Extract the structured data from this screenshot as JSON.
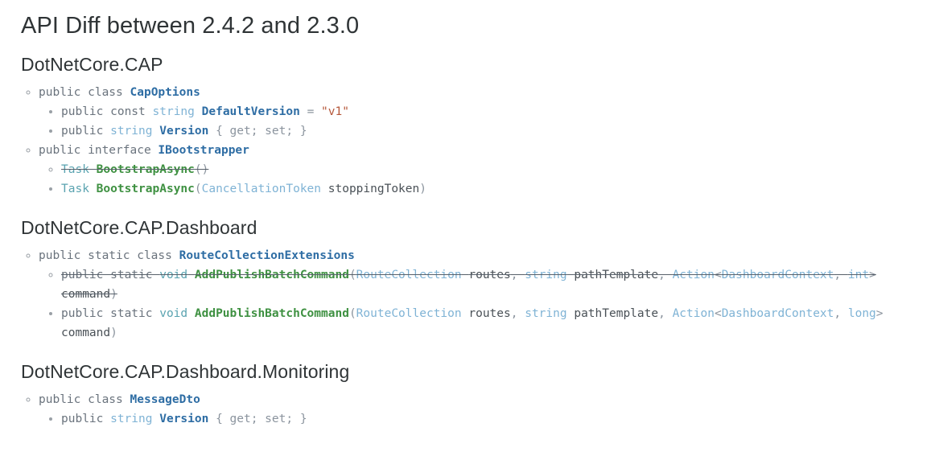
{
  "document": {
    "title": "API Diff between 2.4.2 and 2.3.0"
  },
  "colors": {
    "background": "#ffffff",
    "title": "#2f3436",
    "keyword": "#6a737d",
    "type": "#7fb3d5",
    "identifier": "#2e6da4",
    "method": "#3f9142",
    "string": "#b5573a",
    "removed_strike": "#57606a"
  },
  "namespaces": [
    {
      "name": "DotNetCore.CAP",
      "members": [
        {
          "kind": "class",
          "status": "unchanged",
          "tokens": [
            {
              "t": "public class ",
              "c": "kw"
            },
            {
              "t": "CapOptions",
              "c": "id"
            }
          ],
          "children": [
            {
              "status": "added",
              "tokens": [
                {
                  "t": "public const ",
                  "c": "kw"
                },
                {
                  "t": "string",
                  "c": "type"
                },
                {
                  "t": " ",
                  "c": "kw"
                },
                {
                  "t": "DefaultVersion",
                  "c": "id"
                },
                {
                  "t": " = ",
                  "c": "punc"
                },
                {
                  "t": "\"v1\"",
                  "c": "str"
                }
              ]
            },
            {
              "status": "added",
              "tokens": [
                {
                  "t": "public ",
                  "c": "kw"
                },
                {
                  "t": "string",
                  "c": "type"
                },
                {
                  "t": " ",
                  "c": "kw"
                },
                {
                  "t": "Version",
                  "c": "id"
                },
                {
                  "t": " { get; set; }",
                  "c": "punc"
                }
              ]
            }
          ]
        },
        {
          "kind": "interface",
          "status": "unchanged",
          "tokens": [
            {
              "t": "public interface ",
              "c": "kw"
            },
            {
              "t": "IBootstrapper",
              "c": "id"
            }
          ],
          "children": [
            {
              "status": "removed",
              "tokens": [
                {
                  "t": "Task",
                  "c": "tealtype"
                },
                {
                  "t": " ",
                  "c": "kw"
                },
                {
                  "t": "BootstrapAsync",
                  "c": "fn"
                },
                {
                  "t": "()",
                  "c": "punc"
                }
              ]
            },
            {
              "status": "added",
              "tokens": [
                {
                  "t": "Task",
                  "c": "tealtype"
                },
                {
                  "t": " ",
                  "c": "kw"
                },
                {
                  "t": "BootstrapAsync",
                  "c": "fn"
                },
                {
                  "t": "(",
                  "c": "punc"
                },
                {
                  "t": "CancellationToken",
                  "c": "type"
                },
                {
                  "t": " ",
                  "c": "kw"
                },
                {
                  "t": "stoppingToken",
                  "c": "param"
                },
                {
                  "t": ")",
                  "c": "punc"
                }
              ]
            }
          ]
        }
      ]
    },
    {
      "name": "DotNetCore.CAP.Dashboard",
      "members": [
        {
          "kind": "class",
          "status": "unchanged",
          "tokens": [
            {
              "t": "public static class ",
              "c": "kw"
            },
            {
              "t": "RouteCollectionExtensions",
              "c": "id"
            }
          ],
          "children": [
            {
              "status": "removed",
              "tokens": [
                {
                  "t": "public static ",
                  "c": "kw"
                },
                {
                  "t": "void",
                  "c": "tealtype"
                },
                {
                  "t": " ",
                  "c": "kw"
                },
                {
                  "t": "AddPublishBatchCommand",
                  "c": "fn"
                },
                {
                  "t": "(",
                  "c": "punc"
                },
                {
                  "t": "RouteCollection",
                  "c": "type"
                },
                {
                  "t": " ",
                  "c": "kw"
                },
                {
                  "t": "routes",
                  "c": "param"
                },
                {
                  "t": ", ",
                  "c": "punc"
                },
                {
                  "t": "string",
                  "c": "type"
                },
                {
                  "t": " ",
                  "c": "kw"
                },
                {
                  "t": "pathTemplate",
                  "c": "param"
                },
                {
                  "t": ", ",
                  "c": "punc"
                },
                {
                  "t": "Action",
                  "c": "type"
                },
                {
                  "t": "<",
                  "c": "punc"
                },
                {
                  "t": "DashboardContext",
                  "c": "type"
                },
                {
                  "t": ", ",
                  "c": "punc"
                },
                {
                  "t": "int",
                  "c": "type"
                },
                {
                  "t": "> ",
                  "c": "punc"
                },
                {
                  "t": "command",
                  "c": "param"
                },
                {
                  "t": ")",
                  "c": "punc"
                }
              ]
            },
            {
              "status": "added",
              "tokens": [
                {
                  "t": "public static ",
                  "c": "kw"
                },
                {
                  "t": "void",
                  "c": "tealtype"
                },
                {
                  "t": " ",
                  "c": "kw"
                },
                {
                  "t": "AddPublishBatchCommand",
                  "c": "fn"
                },
                {
                  "t": "(",
                  "c": "punc"
                },
                {
                  "t": "RouteCollection",
                  "c": "type"
                },
                {
                  "t": " ",
                  "c": "kw"
                },
                {
                  "t": "routes",
                  "c": "param"
                },
                {
                  "t": ", ",
                  "c": "punc"
                },
                {
                  "t": "string",
                  "c": "type"
                },
                {
                  "t": " ",
                  "c": "kw"
                },
                {
                  "t": "pathTemplate",
                  "c": "param"
                },
                {
                  "t": ", ",
                  "c": "punc"
                },
                {
                  "t": "Action",
                  "c": "type"
                },
                {
                  "t": "<",
                  "c": "punc"
                },
                {
                  "t": "DashboardContext",
                  "c": "type"
                },
                {
                  "t": ", ",
                  "c": "punc"
                },
                {
                  "t": "long",
                  "c": "type"
                },
                {
                  "t": "> ",
                  "c": "punc"
                },
                {
                  "t": "command",
                  "c": "param"
                },
                {
                  "t": ")",
                  "c": "punc"
                }
              ]
            }
          ]
        }
      ]
    },
    {
      "name": "DotNetCore.CAP.Dashboard.Monitoring",
      "members": [
        {
          "kind": "class",
          "status": "unchanged",
          "tokens": [
            {
              "t": "public class ",
              "c": "kw"
            },
            {
              "t": "MessageDto",
              "c": "id"
            }
          ],
          "children": [
            {
              "status": "added",
              "tokens": [
                {
                  "t": "public ",
                  "c": "kw"
                },
                {
                  "t": "string",
                  "c": "type"
                },
                {
                  "t": " ",
                  "c": "kw"
                },
                {
                  "t": "Version",
                  "c": "id"
                },
                {
                  "t": " { get; set; }",
                  "c": "punc"
                }
              ]
            }
          ]
        }
      ]
    }
  ]
}
